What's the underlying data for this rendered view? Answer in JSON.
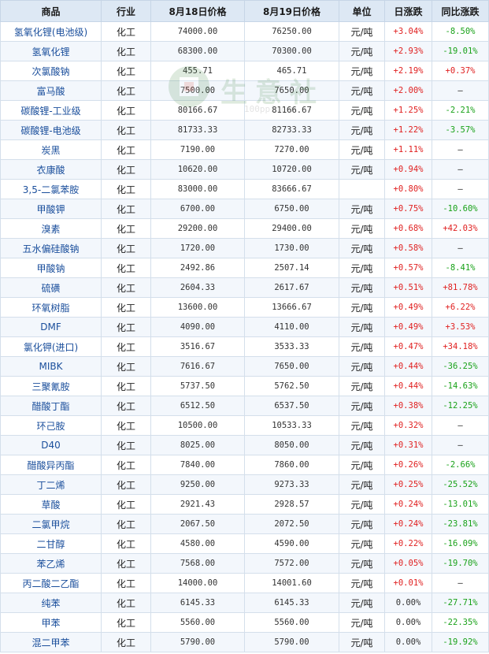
{
  "headers": [
    "商品",
    "行业",
    "8月18日价格",
    "8月19日价格",
    "单位",
    "日涨跌",
    "同比涨跌"
  ],
  "watermark": {
    "text": "生意社",
    "url": "100ppi.com"
  },
  "rows": [
    {
      "name": "氢氧化锂(电池级)",
      "industry": "化工",
      "price1": "74000.00",
      "price2": "76250.00",
      "unit": "元/吨",
      "day": "+3.04%",
      "yoy": "-8.50%"
    },
    {
      "name": "氢氧化锂",
      "industry": "化工",
      "price1": "68300.00",
      "price2": "70300.00",
      "unit": "元/吨",
      "day": "+2.93%",
      "yoy": "-19.01%"
    },
    {
      "name": "次氯酸钠",
      "industry": "化工",
      "price1": "455.71",
      "price2": "465.71",
      "unit": "元/吨",
      "day": "+2.19%",
      "yoy": "+0.37%"
    },
    {
      "name": "富马酸",
      "industry": "化工",
      "price1": "7500.00",
      "price2": "7650.00",
      "unit": "元/吨",
      "day": "+2.00%",
      "yoy": "—"
    },
    {
      "name": "碳酸锂-工业级",
      "industry": "化工",
      "price1": "80166.67",
      "price2": "81166.67",
      "unit": "元/吨",
      "day": "+1.25%",
      "yoy": "-2.21%"
    },
    {
      "name": "碳酸锂-电池级",
      "industry": "化工",
      "price1": "81733.33",
      "price2": "82733.33",
      "unit": "元/吨",
      "day": "+1.22%",
      "yoy": "-3.57%"
    },
    {
      "name": "炭黑",
      "industry": "化工",
      "price1": "7190.00",
      "price2": "7270.00",
      "unit": "元/吨",
      "day": "+1.11%",
      "yoy": "—"
    },
    {
      "name": "衣康酸",
      "industry": "化工",
      "price1": "10620.00",
      "price2": "10720.00",
      "unit": "元/吨",
      "day": "+0.94%",
      "yoy": "—"
    },
    {
      "name": "3,5-二氯苯胺",
      "industry": "化工",
      "price1": "83000.00",
      "price2": "83666.67",
      "unit": "",
      "day": "+0.80%",
      "yoy": "—"
    },
    {
      "name": "甲酸钾",
      "industry": "化工",
      "price1": "6700.00",
      "price2": "6750.00",
      "unit": "元/吨",
      "day": "+0.75%",
      "yoy": "-10.60%"
    },
    {
      "name": "溴素",
      "industry": "化工",
      "price1": "29200.00",
      "price2": "29400.00",
      "unit": "元/吨",
      "day": "+0.68%",
      "yoy": "+42.03%"
    },
    {
      "name": "五水偏硅酸钠",
      "industry": "化工",
      "price1": "1720.00",
      "price2": "1730.00",
      "unit": "元/吨",
      "day": "+0.58%",
      "yoy": "—"
    },
    {
      "name": "甲酸钠",
      "industry": "化工",
      "price1": "2492.86",
      "price2": "2507.14",
      "unit": "元/吨",
      "day": "+0.57%",
      "yoy": "-8.41%"
    },
    {
      "name": "硫磺",
      "industry": "化工",
      "price1": "2604.33",
      "price2": "2617.67",
      "unit": "元/吨",
      "day": "+0.51%",
      "yoy": "+81.78%"
    },
    {
      "name": "环氧树脂",
      "industry": "化工",
      "price1": "13600.00",
      "price2": "13666.67",
      "unit": "元/吨",
      "day": "+0.49%",
      "yoy": "+6.22%"
    },
    {
      "name": "DMF",
      "industry": "化工",
      "price1": "4090.00",
      "price2": "4110.00",
      "unit": "元/吨",
      "day": "+0.49%",
      "yoy": "+3.53%"
    },
    {
      "name": "氯化钾(进口)",
      "industry": "化工",
      "price1": "3516.67",
      "price2": "3533.33",
      "unit": "元/吨",
      "day": "+0.47%",
      "yoy": "+34.18%"
    },
    {
      "name": "MIBK",
      "industry": "化工",
      "price1": "7616.67",
      "price2": "7650.00",
      "unit": "元/吨",
      "day": "+0.44%",
      "yoy": "-36.25%"
    },
    {
      "name": "三聚氰胺",
      "industry": "化工",
      "price1": "5737.50",
      "price2": "5762.50",
      "unit": "元/吨",
      "day": "+0.44%",
      "yoy": "-14.63%"
    },
    {
      "name": "醋酸丁酯",
      "industry": "化工",
      "price1": "6512.50",
      "price2": "6537.50",
      "unit": "元/吨",
      "day": "+0.38%",
      "yoy": "-12.25%"
    },
    {
      "name": "环己胺",
      "industry": "化工",
      "price1": "10500.00",
      "price2": "10533.33",
      "unit": "元/吨",
      "day": "+0.32%",
      "yoy": "—"
    },
    {
      "name": "D40",
      "industry": "化工",
      "price1": "8025.00",
      "price2": "8050.00",
      "unit": "元/吨",
      "day": "+0.31%",
      "yoy": "—"
    },
    {
      "name": "醋酸异丙酯",
      "industry": "化工",
      "price1": "7840.00",
      "price2": "7860.00",
      "unit": "元/吨",
      "day": "+0.26%",
      "yoy": "-2.66%"
    },
    {
      "name": "丁二烯",
      "industry": "化工",
      "price1": "9250.00",
      "price2": "9273.33",
      "unit": "元/吨",
      "day": "+0.25%",
      "yoy": "-25.52%"
    },
    {
      "name": "草酸",
      "industry": "化工",
      "price1": "2921.43",
      "price2": "2928.57",
      "unit": "元/吨",
      "day": "+0.24%",
      "yoy": "-13.01%"
    },
    {
      "name": "二氯甲烷",
      "industry": "化工",
      "price1": "2067.50",
      "price2": "2072.50",
      "unit": "元/吨",
      "day": "+0.24%",
      "yoy": "-23.81%"
    },
    {
      "name": "二甘醇",
      "industry": "化工",
      "price1": "4580.00",
      "price2": "4590.00",
      "unit": "元/吨",
      "day": "+0.22%",
      "yoy": "-16.09%"
    },
    {
      "name": "苯乙烯",
      "industry": "化工",
      "price1": "7568.00",
      "price2": "7572.00",
      "unit": "元/吨",
      "day": "+0.05%",
      "yoy": "-19.70%"
    },
    {
      "name": "丙二酸二乙酯",
      "industry": "化工",
      "price1": "14000.00",
      "price2": "14001.60",
      "unit": "元/吨",
      "day": "+0.01%",
      "yoy": "—"
    },
    {
      "name": "纯苯",
      "industry": "化工",
      "price1": "6145.33",
      "price2": "6145.33",
      "unit": "元/吨",
      "day": "0.00%",
      "yoy": "-27.71%"
    },
    {
      "name": "甲苯",
      "industry": "化工",
      "price1": "5560.00",
      "price2": "5560.00",
      "unit": "元/吨",
      "day": "0.00%",
      "yoy": "-22.35%"
    },
    {
      "name": "混二甲苯",
      "industry": "化工",
      "price1": "5790.00",
      "price2": "5790.00",
      "unit": "元/吨",
      "day": "0.00%",
      "yoy": "-19.92%"
    }
  ]
}
